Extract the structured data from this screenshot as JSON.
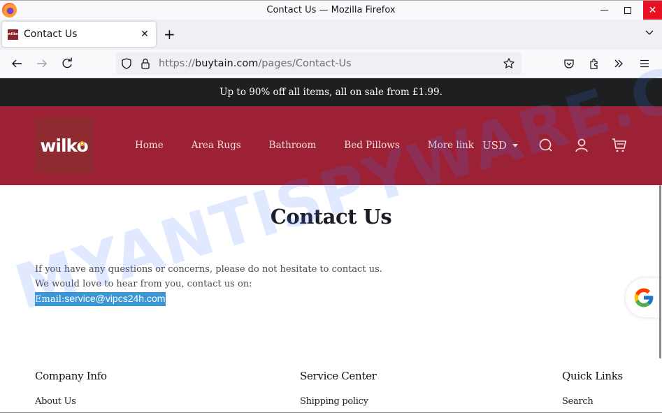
{
  "window": {
    "title": "Contact Us — Mozilla Firefox"
  },
  "tabs": [
    {
      "label": "Contact Us",
      "active": true,
      "favicon": "wilko"
    }
  ],
  "navbar": {
    "url_scheme": "https://",
    "url_host": "buytain.com",
    "url_path": "/pages/Contact-Us"
  },
  "page": {
    "announcement": "Up to 90% off all items, all on sale from £1.99.",
    "logo_text": "wilko",
    "nav": [
      "Home",
      "Area Rugs",
      "Bathroom",
      "Bed Pillows",
      "More link"
    ],
    "currency": "USD",
    "title": "Contact Us",
    "body_lines": [
      "If you have any questions or concerns, please do not hesitate to contact us.",
      "We would love to hear from you, contact us on:"
    ],
    "email_label": "Email:",
    "email_value": "service@vipcs24h.com",
    "footer": {
      "columns": [
        {
          "heading": "Company Info",
          "links": [
            "About Us"
          ]
        },
        {
          "heading": "Service Center",
          "links": [
            "Shipping policy"
          ]
        },
        {
          "heading": "Quick Links",
          "links": [
            "Search"
          ]
        }
      ]
    }
  },
  "colors": {
    "header_bg": "#9d2135",
    "announcement_bg": "#1e1f21",
    "selection_highlight": "#3a97d4",
    "logo_accent": "#f39b1f"
  },
  "watermark": "MYANTISPYWARE.COM"
}
